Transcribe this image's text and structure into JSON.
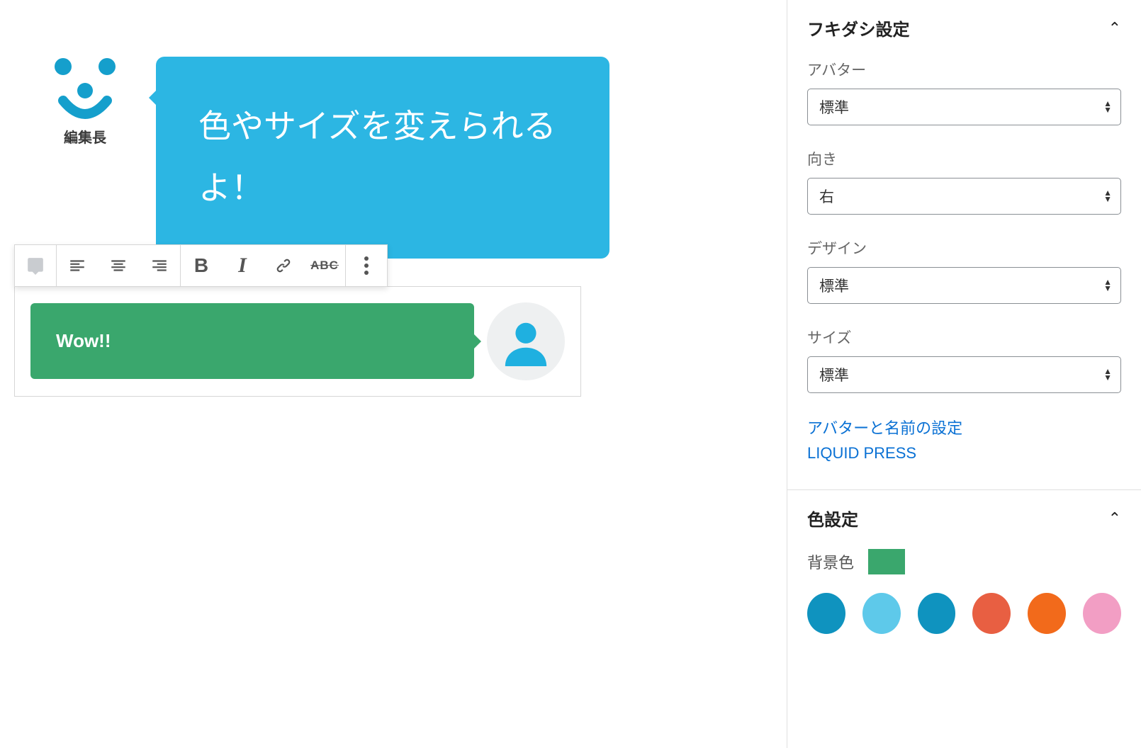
{
  "editor": {
    "avatar1_name": "編集長",
    "bubble1_text": "色やサイズを変えられるよ！",
    "bubble2_text": "Wow!!",
    "toolbar": {
      "strike_label": "ABC"
    }
  },
  "sidebar": {
    "panel1_title": "フキダシ設定",
    "fields": {
      "avatar": {
        "label": "アバター",
        "value": "標準"
      },
      "direction": {
        "label": "向き",
        "value": "右"
      },
      "design": {
        "label": "デザイン",
        "value": "標準"
      },
      "size": {
        "label": "サイズ",
        "value": "標準"
      }
    },
    "links": {
      "avatar_settings": "アバターと名前の設定",
      "liquid_press": "LIQUID PRESS"
    },
    "panel2_title": "色設定",
    "bg_color_label": "背景色",
    "bg_color_value": "#3aa76d",
    "swatches": [
      "#0f93bf",
      "#5ec9ea",
      "#0f93bf",
      "#e85f42",
      "#f26a1b",
      "#f29ec4"
    ]
  }
}
